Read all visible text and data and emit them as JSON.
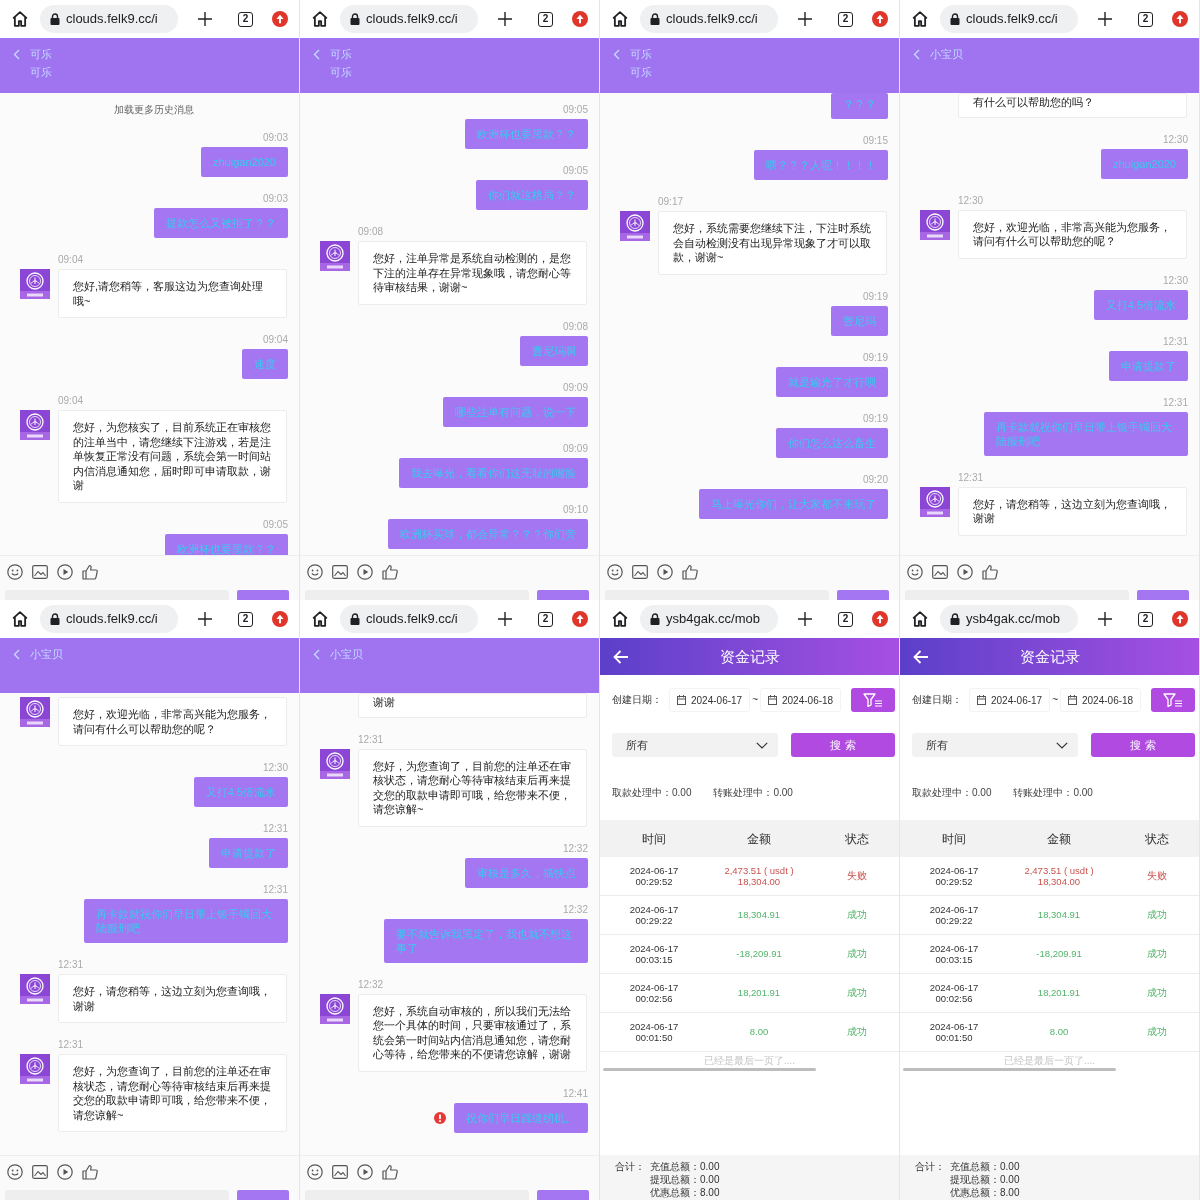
{
  "panels": [
    {
      "kind": "chat",
      "browser": {
        "url": "clouds.felk9.cc/i",
        "tab_count": "2"
      },
      "header": {
        "title": "可乐",
        "subtitle": "可乐"
      },
      "chat": {
        "load_more": "加载更多历史消息",
        "messages": [
          {
            "kind": "user",
            "time": "09:03",
            "text": "zhuigan2020",
            "failed": false
          },
          {
            "kind": "user",
            "time": "09:03",
            "text": "提款怎么又被拒了？？",
            "failed": false
          },
          {
            "kind": "agent",
            "time": "09:04",
            "text": "您好,请您稍等，客服这边为您查询处理哦~",
            "avatar": true,
            "failed": false
          },
          {
            "kind": "user",
            "time": "09:04",
            "text": "速度",
            "failed": false
          },
          {
            "kind": "agent",
            "time": "09:04",
            "text": "您好，为您核实了，目前系统正在审核您的注单当中，请您继续下注游戏，若是注单恢复正常没有问题，系统会第一时间站内信消息通知您，届时即可申请取款，谢谢",
            "avatar": true,
            "failed": false
          },
          {
            "kind": "user",
            "time": "09:05",
            "text": "欧洲杯也要黑款？？",
            "failed": false
          }
        ]
      }
    },
    {
      "kind": "chat",
      "browser": {
        "url": "clouds.felk9.cc/i",
        "tab_count": "2"
      },
      "header": {
        "title": "可乐",
        "subtitle": "可乐"
      },
      "chat": {
        "messages": [
          {
            "kind": "user",
            "time": "09:05",
            "text": "欧洲杯也要黑款？？",
            "failed": false
          },
          {
            "kind": "user",
            "time": "09:05",
            "text": "你们就这格局？？",
            "failed": false
          },
          {
            "kind": "agent",
            "time": "09:08",
            "text": "您好，注单异常是系统自动检测的，是您下注的注单存在异常现象哦，请您耐心等待审核结果，谢谢~",
            "avatar": true,
            "failed": false
          },
          {
            "kind": "user",
            "time": "09:08",
            "text": "曹尼玛啊",
            "failed": false
          },
          {
            "kind": "user",
            "time": "09:09",
            "text": "哪些注单有问题，说一下",
            "failed": false
          },
          {
            "kind": "user",
            "time": "09:09",
            "text": "我去曝光，看看你们这无耻的嘴脸",
            "failed": false
          },
          {
            "kind": "user",
            "time": "09:10",
            "text": "欧洲杯买球，都会异常？？？你们旁",
            "failed": false
          }
        ]
      }
    },
    {
      "kind": "chat",
      "browser": {
        "url": "clouds.felk9.cc/i",
        "tab_count": "2"
      },
      "header": {
        "title": "可乐",
        "subtitle": "可乐"
      },
      "chat": {
        "messages": [
          {
            "kind": "user",
            "text": "？？？",
            "failed": false
          },
          {
            "kind": "user",
            "time": "09:15",
            "text": "喂？？？人呢！！！！",
            "failed": false
          },
          {
            "kind": "agent",
            "time": "09:17",
            "text": "您好，系统需要您继续下注，下注时系统会自动检测没有出现异常现象了才可以取款，谢谢~",
            "avatar": true,
            "failed": false
          },
          {
            "kind": "user",
            "time": "09:19",
            "text": "曹尼玛",
            "failed": false
          },
          {
            "kind": "user",
            "time": "09:19",
            "text": "就是输光了才行呗",
            "failed": false
          },
          {
            "kind": "user",
            "time": "09:19",
            "text": "你们怎么这么畜生",
            "failed": false
          },
          {
            "kind": "user",
            "time": "09:20",
            "text": "马上曝光你们，让大家都不来玩了",
            "failed": false
          }
        ]
      }
    },
    {
      "kind": "chat",
      "browser": {
        "url": "clouds.felk9.cc/i",
        "tab_count": "2"
      },
      "header": {
        "title": "小宝贝"
      },
      "chat": {
        "messages": [
          {
            "kind": "agent",
            "text": "有什么可以帮助您的吗？",
            "avatar": false,
            "failed": false
          },
          {
            "kind": "user",
            "time": "12:30",
            "text": "zhuigan2020",
            "failed": false
          },
          {
            "kind": "agent",
            "time": "12:30",
            "text": "您好，欢迎光临，非常高兴能为您服务，请问有什么可以帮助您的呢？",
            "avatar": true,
            "failed": false
          },
          {
            "kind": "user",
            "time": "12:30",
            "text": "又打4.5倍流水",
            "failed": false
          },
          {
            "kind": "user",
            "time": "12:31",
            "text": "申请提款了",
            "failed": false
          },
          {
            "kind": "user",
            "time": "12:31",
            "text": "再卡款就祝你们早日带上银手镯回大陆服刑吧",
            "failed": false
          },
          {
            "kind": "agent",
            "time": "12:31",
            "text": "您好，请您稍等，这边立刻为您查询哦，谢谢",
            "avatar": true,
            "failed": false
          }
        ]
      }
    },
    {
      "kind": "chat",
      "browser": {
        "url": "clouds.felk9.cc/i",
        "tab_count": "2"
      },
      "header": {
        "title": "小宝贝"
      },
      "chat": {
        "messages": [
          {
            "kind": "agent",
            "text": "您好，欢迎光临，非常高兴能为您服务，请问有什么可以帮助您的呢？",
            "avatar": true,
            "failed": false
          },
          {
            "kind": "user",
            "time": "12:30",
            "text": "又打4.5倍流水",
            "failed": false
          },
          {
            "kind": "user",
            "time": "12:31",
            "text": "申请提款了",
            "failed": false
          },
          {
            "kind": "user",
            "time": "12:31",
            "text": "再卡款就祝你们早日带上银手镯回大陆服刑吧",
            "failed": false
          },
          {
            "kind": "agent",
            "time": "12:31",
            "text": "您好，请您稍等，这边立刻为您查询哦，谢谢",
            "avatar": true,
            "failed": false
          },
          {
            "kind": "agent",
            "time": "12:31",
            "text": "您好，为您查询了，目前您的注单还在审核状态，请您耐心等待审核结束后再来提交您的取款申请即可哦，给您带来不便，请您谅解~",
            "avatar": true,
            "failed": false
          }
        ]
      }
    },
    {
      "kind": "chat",
      "browser": {
        "url": "clouds.felk9.cc/i",
        "tab_count": "2"
      },
      "header": {
        "title": "小宝贝"
      },
      "chat": {
        "messages": [
          {
            "kind": "agent",
            "text": "谢谢",
            "avatar": false,
            "failed": false
          },
          {
            "kind": "agent",
            "time": "12:31",
            "text": "您好，为您查询了，目前您的注单还在审核状态，请您耐心等待审核结束后再来提交您的取款申请即可哦，给您带来不便，请您谅解~",
            "avatar": true,
            "failed": false
          },
          {
            "kind": "user",
            "time": "12:32",
            "text": "审核是多久，搞快点",
            "failed": false
          },
          {
            "kind": "user",
            "time": "12:32",
            "text": "要不就告诉我黑定了，我也就不想这事了",
            "failed": false
          },
          {
            "kind": "agent",
            "time": "12:32",
            "text": "您好，系统自动审核的，所以我们无法给您一个具体的时间，只要审核通过了，系统会第一时间站内信消息通知您，请您耐心等待，给您带来的不便请您谅解，谢谢",
            "avatar": true,
            "failed": false
          },
          {
            "kind": "user",
            "time": "12:41",
            "text": "祝你们早日踩缝纫机。",
            "failed": true
          }
        ]
      }
    },
    {
      "kind": "records",
      "browser": {
        "url": "ysb4gak.cc/mob",
        "tab_count": "2"
      },
      "header": {
        "title": "资金记录"
      },
      "filters": {
        "date_label": "创建日期：",
        "date_from": "2024-06-17",
        "date_separator": "~",
        "date_to": "2024-06-18",
        "type_select": "所有",
        "search_button": "搜 索"
      },
      "pending": [
        "取款处理中：0.00",
        "转账处理中：0.00"
      ],
      "table": {
        "columns": [
          "时间",
          "金额",
          "状态"
        ],
        "rows": [
          {
            "date": "2024-06-17",
            "time": "00:29:52",
            "amount_lines": [
              "2,473.51 ( usdt )",
              "18,304.00"
            ],
            "status": "失败",
            "kind": "failed"
          },
          {
            "date": "2024-06-17",
            "time": "00:29:22",
            "amount_lines": [
              "18,304.91"
            ],
            "status": "成功",
            "kind": "success"
          },
          {
            "date": "2024-06-17",
            "time": "00:03:15",
            "amount_lines": [
              "-18,209.91"
            ],
            "status": "成功",
            "kind": "success"
          },
          {
            "date": "2024-06-17",
            "time": "00:02:56",
            "amount_lines": [
              "18,201.91"
            ],
            "status": "成功",
            "kind": "success"
          },
          {
            "date": "2024-06-17",
            "time": "00:01:50",
            "amount_lines": [
              "8.00"
            ],
            "status": "成功",
            "kind": "success"
          }
        ]
      },
      "end_note": "已经是最后一页了....",
      "totals": {
        "label": "合计：",
        "lines": [
          "充值总额：0.00",
          "提现总额：0.00",
          "优惠总额：8.00"
        ]
      }
    },
    {
      "kind": "records",
      "browser": {
        "url": "ysb4gak.cc/mob",
        "tab_count": "2"
      },
      "header": {
        "title": "资金记录"
      },
      "filters": {
        "date_label": "创建日期：",
        "date_from": "2024-06-17",
        "date_separator": "~",
        "date_to": "2024-06-18",
        "type_select": "所有",
        "search_button": "搜 索"
      },
      "pending": [
        "取款处理中：0.00",
        "转账处理中：0.00"
      ],
      "table": {
        "columns": [
          "时间",
          "金额",
          "状态"
        ],
        "rows": [
          {
            "date": "2024-06-17",
            "time": "00:29:52",
            "amount_lines": [
              "2,473.51 ( usdt )",
              "18,304.00"
            ],
            "status": "失败",
            "kind": "failed"
          },
          {
            "date": "2024-06-17",
            "time": "00:29:22",
            "amount_lines": [
              "18,304.91"
            ],
            "status": "成功",
            "kind": "success"
          },
          {
            "date": "2024-06-17",
            "time": "00:03:15",
            "amount_lines": [
              "-18,209.91"
            ],
            "status": "成功",
            "kind": "success"
          },
          {
            "date": "2024-06-17",
            "time": "00:02:56",
            "amount_lines": [
              "18,201.91"
            ],
            "status": "成功",
            "kind": "success"
          },
          {
            "date": "2024-06-17",
            "time": "00:01:50",
            "amount_lines": [
              "8.00"
            ],
            "status": "成功",
            "kind": "success"
          }
        ]
      },
      "end_note": "已经是最后一页了....",
      "totals": {
        "label": "合计：",
        "lines": [
          "充值总额：0.00",
          "提现总额：0.00",
          "优惠总额：8.00"
        ]
      }
    }
  ]
}
